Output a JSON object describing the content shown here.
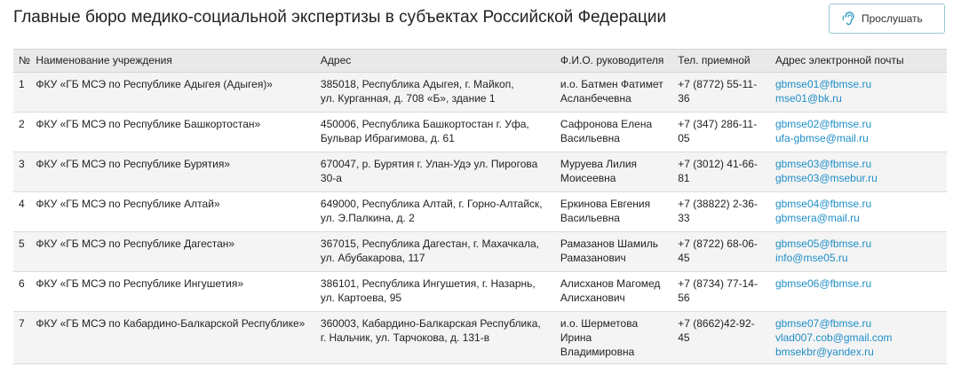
{
  "page": {
    "title": "Главные бюро медико-социальной экспертизы в субъектах Российской Федерации",
    "listen_button": {
      "label": "Прослушать",
      "icon": "hearing-icon"
    }
  },
  "colors": {
    "link": "#1f8ec7",
    "header_bg": "#e9e9e9",
    "row_alt": "#f4f4f4",
    "button_border": "#9bc7d6"
  },
  "table": {
    "columns": [
      "№",
      "Наименование учреждения",
      "Адрес",
      "Ф.И.О. руководителя",
      "Тел. приемной",
      "Адрес электронной почты"
    ],
    "rows": [
      {
        "num": "1",
        "name": "ФКУ «ГБ МСЭ по Республике Адыгея (Адыгея)»",
        "address": [
          "385018, Республика Адыгея, г. Майкоп,",
          "ул. Курганная, д. 708 «Б», здание 1"
        ],
        "head": [
          "и.о. Батмен Фатимет",
          "Асланбечевна"
        ],
        "phone": "+7 (8772) 55-11-36",
        "emails": [
          "gbmse01@fbmse.ru",
          "mse01@bk.ru"
        ]
      },
      {
        "num": "2",
        "name": "ФКУ «ГБ МСЭ по Республике Башкортостан»",
        "address": [
          "450006, Республика Башкортостан г. Уфа,",
          "Бульвар Ибрагимова, д. 61"
        ],
        "head": [
          "Сафронова Елена",
          "Васильевна"
        ],
        "phone": "+7 (347) 286-11-05",
        "emails": [
          "gbmse02@fbmse.ru",
          "ufa-gbmse@mail.ru"
        ]
      },
      {
        "num": "3",
        "name": "ФКУ «ГБ МСЭ по Республике Бурятия»",
        "address": [
          "670047, р. Бурятия г. Улан-Удэ ул. Пирогова",
          "30-а"
        ],
        "head": [
          "Муруева Лилия",
          "Моисеевна"
        ],
        "phone": "+7 (3012) 41-66-81",
        "emails": [
          "gbmse03@fbmse.ru",
          "gbmse03@msebur.ru"
        ]
      },
      {
        "num": "4",
        "name": "ФКУ «ГБ МСЭ по Республике Алтай»",
        "address": [
          "649000, Республика Алтай, г. Горно-Алтайск,",
          "ул. Э.Палкина, д. 2"
        ],
        "head": [
          "Еркинова Евгения",
          "Васильевна"
        ],
        "phone": "+7 (38822) 2-36-33",
        "emails": [
          "gbmse04@fbmse.ru",
          "gbmsera@mail.ru"
        ]
      },
      {
        "num": "5",
        "name": "ФКУ «ГБ МСЭ по Республике Дагестан»",
        "address": [
          "367015, Республика Дагестан, г. Махачкала,",
          "ул. Абубакарова, 117"
        ],
        "head": [
          "Рамазанов Шамиль",
          "Рамазанович"
        ],
        "phone": "+7 (8722) 68-06-45",
        "emails": [
          "gbmse05@fbmse.ru",
          "info@mse05.ru"
        ]
      },
      {
        "num": "6",
        "name": "ФКУ «ГБ МСЭ по Республике Ингушетия»",
        "address": [
          "386101, Республика Ингушетия, г. Назарнь,",
          "ул. Картоева, 95"
        ],
        "head": [
          "Алисханов Магомед",
          "Алисханович"
        ],
        "phone": "+7 (8734) 77-14-56",
        "emails": [
          "gbmse06@fbmse.ru"
        ]
      },
      {
        "num": "7",
        "name": "ФКУ «ГБ МСЭ по Кабардино-Балкарской Республике»",
        "address": [
          "360003, Кабардино-Балкарская Республика,",
          "г. Нальчик, ул. Тарчокова, д. 131-в"
        ],
        "head": [
          "и.о. Шерметова Ирина",
          "Владимировна"
        ],
        "phone": "+7 (8662)42-92-45",
        "emails": [
          "gbmse07@fbmse.ru",
          "vlad007.cob@gmail.com",
          "bmsekbr@yandex.ru"
        ]
      }
    ]
  }
}
